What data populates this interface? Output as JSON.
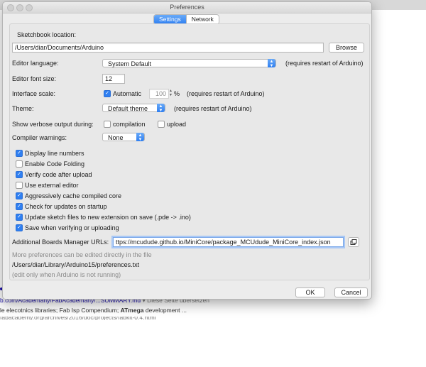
{
  "background": {
    "line1": "b.com/Academany/FabAcademany/...SUMMARY.md",
    "line1_extra": "▾ Diese Seite übersetzen",
    "line2_pre": "le elecotnics libraries; Fab Isp Compendium; ",
    "line2_bold": "ATmega",
    "line2_post": " development ...",
    "line3": "fabacademy.org/archives/2016/doc/projects/fabkit-0.4.html"
  },
  "window": {
    "title": "Preferences"
  },
  "tabs": [
    {
      "label": "Settings",
      "active": true
    },
    {
      "label": "Network",
      "active": false
    }
  ],
  "settings": {
    "sketchbook_label": "Sketchbook location:",
    "sketchbook_path": "/Users/diar/Documents/Arduino",
    "browse_label": "Browse",
    "editor_language_label": "Editor language:",
    "editor_language_value": "System Default",
    "editor_language_note": "(requires restart of Arduino)",
    "font_size_label": "Editor font size:",
    "font_size_value": "12",
    "interface_scale_label": "Interface scale:",
    "automatic_label": "Automatic",
    "automatic_checked": true,
    "scale_value": "100",
    "scale_unit": "%",
    "scale_note": "(requires restart of Arduino)",
    "theme_label": "Theme:",
    "theme_value": "Default theme",
    "theme_note": "(requires restart of Arduino)",
    "verbose_label": "Show verbose output during:",
    "compilation_label": "compilation",
    "compilation_checked": false,
    "upload_label": "upload",
    "upload_checked": false,
    "warnings_label": "Compiler warnings:",
    "warnings_value": "None",
    "options": [
      {
        "label": "Display line numbers",
        "checked": true
      },
      {
        "label": "Enable Code Folding",
        "checked": false
      },
      {
        "label": "Verify code after upload",
        "checked": true
      },
      {
        "label": "Use external editor",
        "checked": false
      },
      {
        "label": "Aggressively cache compiled core",
        "checked": true
      },
      {
        "label": "Check for updates on startup",
        "checked": true
      },
      {
        "label": "Update sketch files to new extension on save (.pde -> .ino)",
        "checked": true
      },
      {
        "label": "Save when verifying or uploading",
        "checked": true
      }
    ],
    "boards_label": "Additional Boards Manager URLs:",
    "boards_value": "ttps://mcudude.github.io/MiniCore/package_MCUdude_MiniCore_index.json",
    "more_prefs": "More preferences can be edited directly in the file",
    "prefs_path": "/Users/diar/Library/Arduino15/preferences.txt",
    "edit_note": "(edit only when Arduino is not running)"
  },
  "footer": {
    "ok_label": "OK",
    "cancel_label": "Cancel"
  },
  "colors": {
    "accent": "#2f7ff1",
    "window_bg": "#ececec"
  }
}
